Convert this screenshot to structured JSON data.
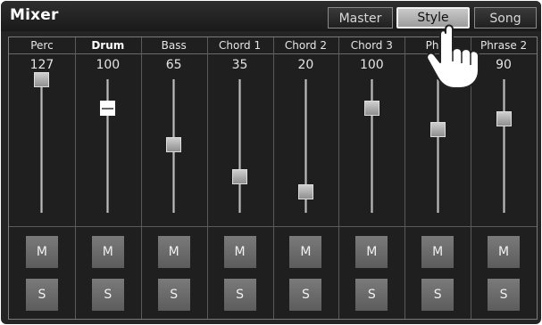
{
  "app": {
    "title": "Mixer"
  },
  "tabs": [
    {
      "label": "Master",
      "selected": false
    },
    {
      "label": "Style",
      "selected": true
    },
    {
      "label": "Song",
      "selected": false
    }
  ],
  "channels": [
    {
      "name": "Perc",
      "value": "127",
      "level": 127,
      "selected": false,
      "mute_label": "M",
      "solo_label": "S"
    },
    {
      "name": "Drum",
      "value": "100",
      "level": 100,
      "selected": true,
      "mute_label": "M",
      "solo_label": "S"
    },
    {
      "name": "Bass",
      "value": "65",
      "level": 65,
      "selected": false,
      "mute_label": "M",
      "solo_label": "S"
    },
    {
      "name": "Chord 1",
      "value": "35",
      "level": 35,
      "selected": false,
      "mute_label": "M",
      "solo_label": "S"
    },
    {
      "name": "Chord 2",
      "value": "20",
      "level": 20,
      "selected": false,
      "mute_label": "M",
      "solo_label": "S"
    },
    {
      "name": "Chord 3",
      "value": "100",
      "level": 100,
      "selected": false,
      "mute_label": "M",
      "solo_label": "S"
    },
    {
      "name": "Phra",
      "value": "8",
      "level": 80,
      "selected": false,
      "mute_label": "M",
      "solo_label": "S"
    },
    {
      "name": "Phrase 2",
      "value": "90",
      "level": 90,
      "selected": false,
      "mute_label": "M",
      "solo_label": "S"
    }
  ],
  "level_max": 127,
  "pointer": {
    "icon": "hand-pointer-icon"
  }
}
